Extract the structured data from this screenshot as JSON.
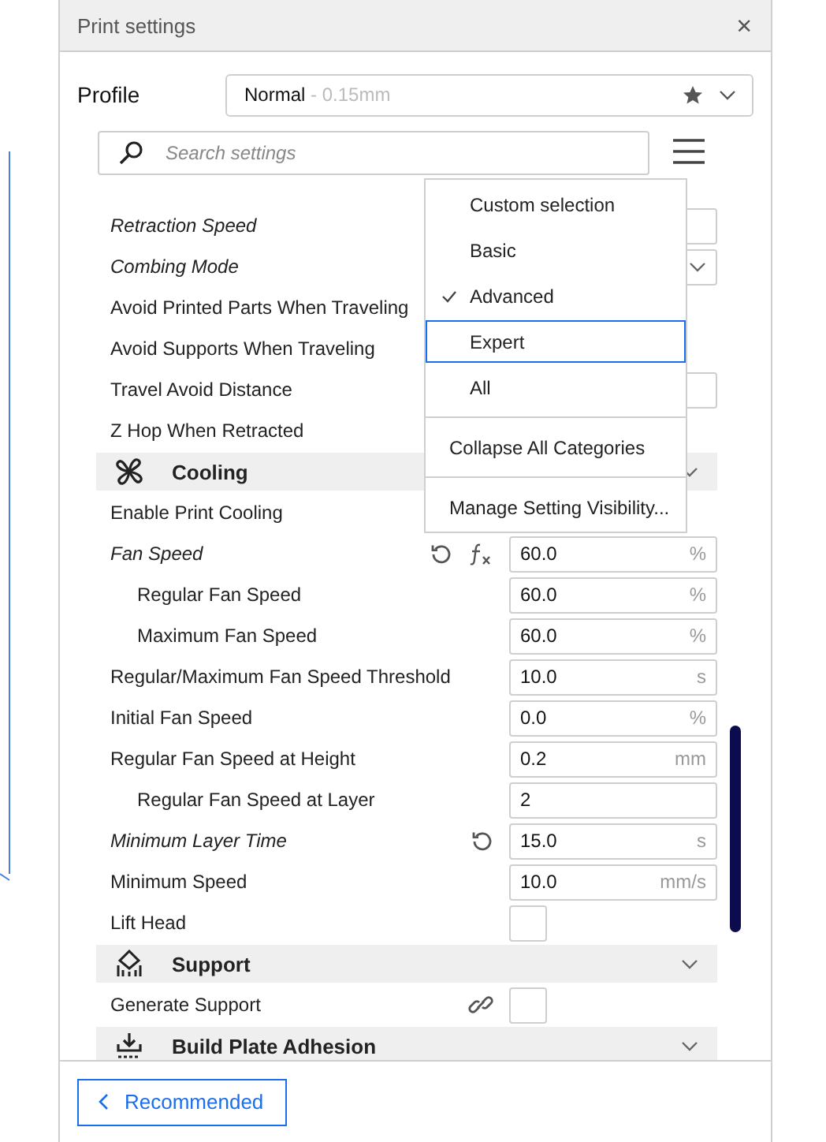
{
  "window": {
    "title": "Print settings",
    "close": "×"
  },
  "profile": {
    "label": "Profile",
    "name": "Normal",
    "detail": " - 0.15mm",
    "favorite": true
  },
  "search": {
    "placeholder": "Search settings"
  },
  "settings_list": [
    {
      "kind": "field",
      "label": "Retraction Speed",
      "modified": true
    },
    {
      "kind": "select",
      "label": "Combing Mode",
      "modified": true
    },
    {
      "kind": "plain",
      "label": "Avoid Printed Parts When Traveling",
      "modified": false
    },
    {
      "kind": "plain",
      "label": "Avoid Supports When Traveling",
      "modified": false
    },
    {
      "kind": "field",
      "label": "Travel Avoid Distance",
      "modified": false
    },
    {
      "kind": "plain",
      "label": "Z Hop When Retracted",
      "modified": false
    },
    {
      "kind": "category",
      "title": "Cooling",
      "settings": [
        {
          "kind": "plain",
          "label": "Enable Print Cooling",
          "modified": false
        },
        {
          "kind": "field",
          "label": "Fan Speed",
          "modified": true,
          "reset": true,
          "formula": true,
          "value": "60.0",
          "unit": "%",
          "children": [
            {
              "kind": "field",
              "label": "Regular Fan Speed",
              "modified": false,
              "value": "60.0",
              "unit": "%"
            },
            {
              "kind": "field",
              "label": "Maximum Fan Speed",
              "modified": false,
              "value": "60.0",
              "unit": "%"
            }
          ]
        },
        {
          "kind": "field",
          "label": "Regular/Maximum Fan Speed Threshold",
          "modified": false,
          "value": "10.0",
          "unit": "s"
        },
        {
          "kind": "field",
          "label": "Initial Fan Speed",
          "modified": false,
          "value": "0.0",
          "unit": "%"
        },
        {
          "kind": "field",
          "label": "Regular Fan Speed at Height",
          "modified": false,
          "value": "0.2",
          "unit": "mm",
          "children": [
            {
              "kind": "field",
              "label": "Regular Fan Speed at Layer",
              "modified": false,
              "value": "2"
            }
          ]
        },
        {
          "kind": "field",
          "label": "Minimum Layer Time",
          "modified": true,
          "reset": true,
          "value": "15.0",
          "unit": "s"
        },
        {
          "kind": "field",
          "label": "Minimum Speed",
          "modified": false,
          "value": "10.0",
          "unit": "mm/s"
        },
        {
          "kind": "checkbox",
          "label": "Lift Head",
          "modified": false,
          "checked": false
        }
      ]
    },
    {
      "kind": "category",
      "title": "Support",
      "settings": [
        {
          "kind": "checkbox",
          "label": "Generate Support",
          "modified": false,
          "linked": true,
          "checked": false
        }
      ]
    },
    {
      "kind": "category",
      "title": "Build Plate Adhesion"
    }
  ],
  "visibility_menu": [
    {
      "kind": "item",
      "label": "Custom selection",
      "checked": false,
      "highlighted": false
    },
    {
      "kind": "item",
      "label": "Basic",
      "checked": false,
      "highlighted": false
    },
    {
      "kind": "item",
      "label": "Advanced",
      "checked": true,
      "highlighted": false
    },
    {
      "kind": "item",
      "label": "Expert",
      "checked": false,
      "highlighted": true
    },
    {
      "kind": "item",
      "label": "All",
      "checked": false,
      "highlighted": false
    },
    {
      "kind": "separator"
    },
    {
      "kind": "action",
      "label": "Collapse All Categories"
    },
    {
      "kind": "separator"
    },
    {
      "kind": "action",
      "label": "Manage Setting Visibility..."
    }
  ],
  "footer": {
    "button": "Recommended"
  }
}
